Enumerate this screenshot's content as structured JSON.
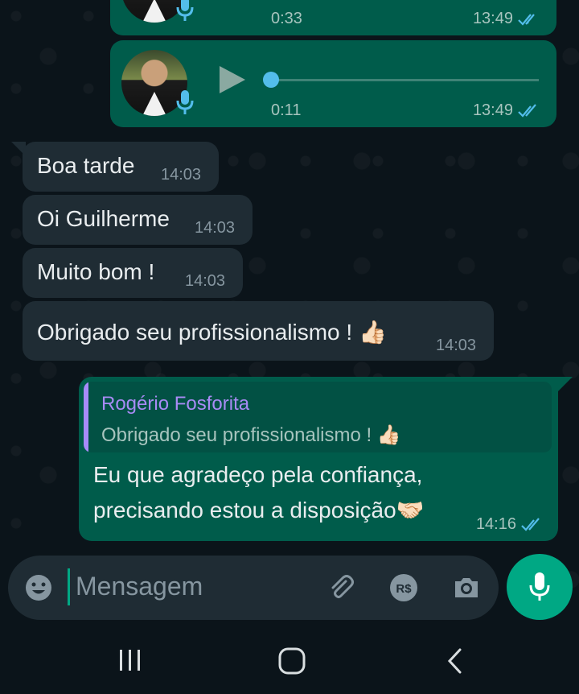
{
  "voice_messages": [
    {
      "duration": "0:33",
      "time": "13:49"
    },
    {
      "duration": "0:11",
      "time": "13:49"
    }
  ],
  "incoming": [
    {
      "text": "Boa tarde",
      "time": "14:03"
    },
    {
      "text": "Oi Guilherme",
      "time": "14:03"
    },
    {
      "text": "Muito bom !",
      "time": "14:03"
    },
    {
      "text": "Obrigado seu profissionalismo ! 👍🏻",
      "time": "14:03"
    }
  ],
  "reply": {
    "quoted_author": "Rogério Fosforita",
    "quoted_text": "Obrigado seu profissionalismo ! 👍🏻",
    "line1": "Eu que agradeço pela confiança,",
    "line2": "precisando estou a disposição🤝🏻",
    "time": "14:16"
  },
  "composer": {
    "placeholder": "Mensagem",
    "icons": [
      "emoji-icon",
      "paperclip-icon",
      "currency-icon",
      "camera-icon",
      "microphone-icon"
    ]
  },
  "colors": {
    "outgoing_bubble": "#005c4b",
    "incoming_bubble": "#1f2c34",
    "accent": "#00a884",
    "read_ticks": "#53bdeb",
    "quote_author": "#a88bf5"
  }
}
